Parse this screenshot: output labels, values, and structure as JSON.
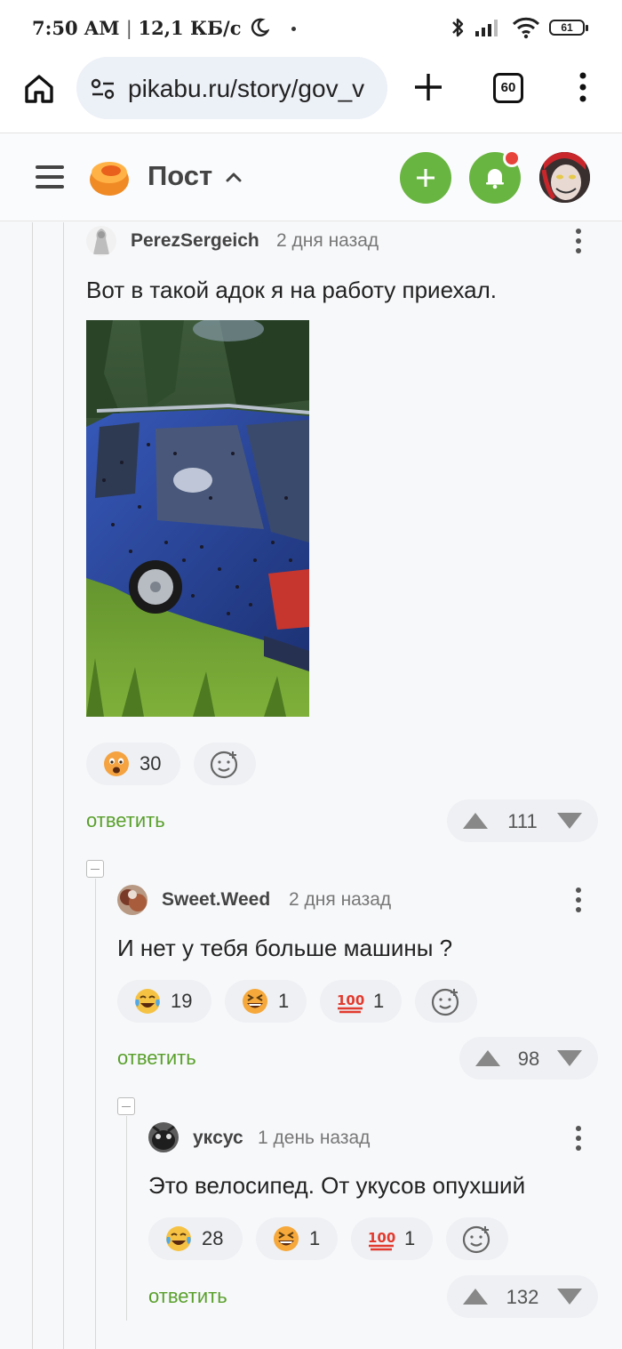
{
  "status_bar": {
    "time": "7:50 AM",
    "net_speed": "12,1 КБ/с",
    "battery": "61"
  },
  "browser": {
    "url": "pikabu.ru/story/gov_v",
    "tab_count": "60"
  },
  "header": {
    "title": "Пост",
    "notification_badge": true
  },
  "colors": {
    "accent_green": "#69b541",
    "link_green": "#5aa02c",
    "badge_red": "#e8433a"
  },
  "comments": [
    {
      "author": "PerezSergeich",
      "time": "2 дня назад",
      "text": "Вот в такой адок я на работу приехал.",
      "has_image": true,
      "reactions": [
        {
          "icon": "shocked-face-emoji",
          "count": "30"
        }
      ],
      "reply_label": "ответить",
      "rating": "111"
    },
    {
      "author": "Sweet.Weed",
      "time": "2 дня назад",
      "text": "И нет у тебя больше машины ?",
      "reactions": [
        {
          "icon": "tears-of-joy-emoji",
          "count": "19"
        },
        {
          "icon": "grinning-squinting-emoji",
          "count": "1"
        },
        {
          "icon": "hundred-points-emoji",
          "count": "1"
        }
      ],
      "reply_label": "ответить",
      "rating": "98"
    },
    {
      "author": "укcус",
      "time": "1 день назад",
      "text": "Это велосипед. От укусов опухший",
      "reactions": [
        {
          "icon": "tears-of-joy-emoji",
          "count": "28"
        },
        {
          "icon": "grinning-squinting-emoji",
          "count": "1"
        },
        {
          "icon": "hundred-points-emoji",
          "count": "1"
        }
      ],
      "reply_label": "ответить",
      "rating": "132"
    }
  ]
}
